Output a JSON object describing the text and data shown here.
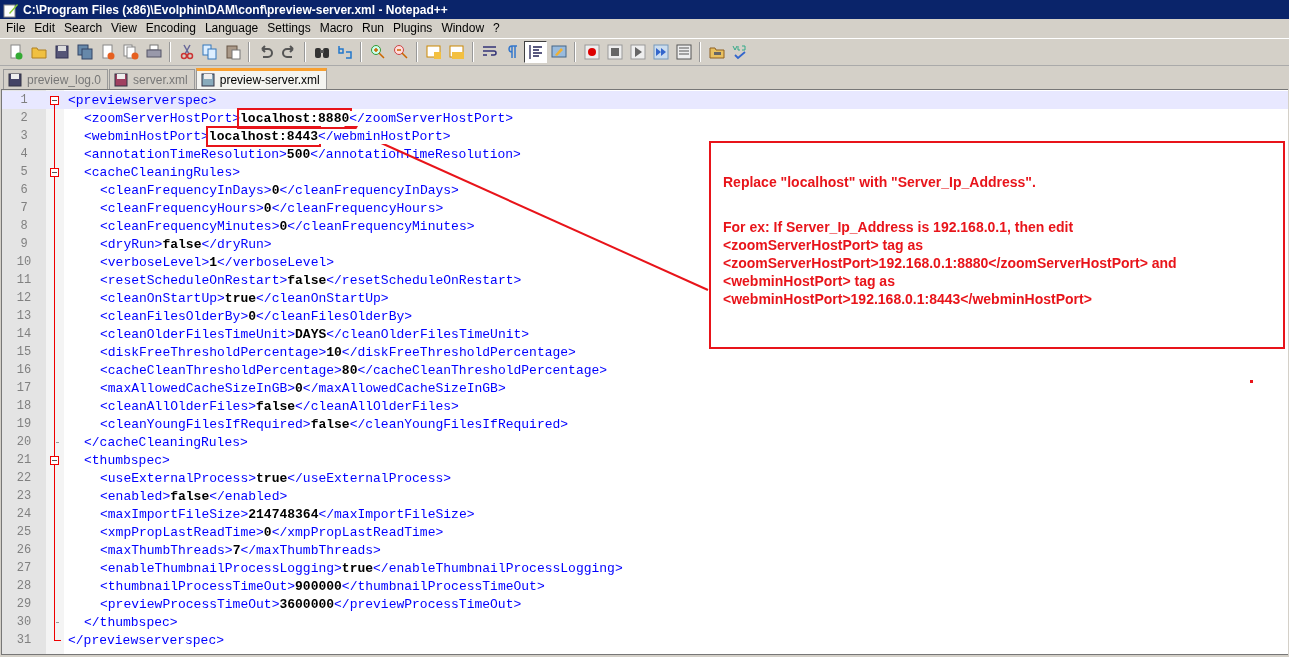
{
  "window": {
    "title": "C:\\Program Files (x86)\\Evolphin\\DAM\\conf\\preview-server.xml - Notepad++"
  },
  "menu": [
    "File",
    "Edit",
    "Search",
    "View",
    "Encoding",
    "Language",
    "Settings",
    "Macro",
    "Run",
    "Plugins",
    "Window",
    "?"
  ],
  "toolbar": [
    {
      "kind": "new",
      "pressed": false
    },
    {
      "kind": "open",
      "pressed": false
    },
    {
      "kind": "save",
      "pressed": false
    },
    {
      "kind": "save_all",
      "pressed": false
    },
    {
      "kind": "close",
      "pressed": false
    },
    {
      "kind": "close_all",
      "pressed": false
    },
    {
      "kind": "print",
      "pressed": false
    },
    {
      "kind": "separator"
    },
    {
      "kind": "cut",
      "pressed": false
    },
    {
      "kind": "copy",
      "pressed": false
    },
    {
      "kind": "paste",
      "pressed": false
    },
    {
      "kind": "separator"
    },
    {
      "kind": "undo",
      "pressed": false
    },
    {
      "kind": "redo",
      "pressed": false
    },
    {
      "kind": "separator"
    },
    {
      "kind": "find",
      "pressed": false
    },
    {
      "kind": "replace",
      "pressed": false
    },
    {
      "kind": "separator"
    },
    {
      "kind": "zoom_in",
      "pressed": false
    },
    {
      "kind": "zoom_out",
      "pressed": false
    },
    {
      "kind": "separator"
    },
    {
      "kind": "sync_vertical",
      "pressed": false
    },
    {
      "kind": "sync_horizontal",
      "pressed": false
    },
    {
      "kind": "separator"
    },
    {
      "kind": "word_wrap",
      "pressed": false
    },
    {
      "kind": "all_chars",
      "pressed": false
    },
    {
      "kind": "indent_guide",
      "pressed": true
    },
    {
      "kind": "monitor",
      "pressed": false
    },
    {
      "kind": "separator"
    },
    {
      "kind": "record",
      "pressed": false
    },
    {
      "kind": "stop",
      "pressed": false
    },
    {
      "kind": "play",
      "pressed": false
    },
    {
      "kind": "play_multiple",
      "pressed": false
    },
    {
      "kind": "save_macro",
      "pressed": false
    },
    {
      "kind": "separator"
    },
    {
      "kind": "folder",
      "pressed": false
    },
    {
      "kind": "spell_check",
      "pressed": false
    }
  ],
  "tabs": [
    {
      "label": "preview_log.0",
      "selected": false,
      "modified": false
    },
    {
      "label": "server.xml",
      "selected": false,
      "modified": true
    },
    {
      "label": "preview-server.xml",
      "selected": true,
      "modified": false
    }
  ],
  "editor": {
    "root": {
      "line": "1",
      "open": "<previewserverspec>",
      "close_line": "31",
      "close": "</previewserverspec>",
      "expanded": true,
      "current": true,
      "children": [
        {
          "line": "2",
          "open": "<zoomServerHostPort>",
          "value": "localhost:8880",
          "close": "</zoomServerHostPort>",
          "boxed": true,
          "current": false
        },
        {
          "line": "3",
          "open": "<webminHostPort>",
          "value": "localhost:8443",
          "close": "</webminHostPort>",
          "boxed": true,
          "current": false
        },
        {
          "line": "4",
          "open": "<annotationTimeResolution>",
          "value": "500",
          "close": "</annotationTimeResolution>",
          "boxed": false,
          "current": false
        },
        {
          "line": "5",
          "open": "<cacheCleaningRules>",
          "close_line": "20",
          "close": "</cacheCleaningRules>",
          "expanded": true,
          "current": false,
          "children": [
            {
              "line": "6",
              "open": "<cleanFrequencyInDays>",
              "value": "0",
              "close": "</cleanFrequencyInDays>",
              "boxed": false,
              "current": false
            },
            {
              "line": "7",
              "open": "<cleanFrequencyHours>",
              "value": "0",
              "close": "</cleanFrequencyHours>",
              "boxed": false,
              "current": false
            },
            {
              "line": "8",
              "open": "<cleanFrequencyMinutes>",
              "value": "0",
              "close": "</cleanFrequencyMinutes>",
              "boxed": false,
              "current": false
            },
            {
              "line": "9",
              "open": "<dryRun>",
              "value": "false",
              "close": "</dryRun>",
              "boxed": false,
              "current": false
            },
            {
              "line": "10",
              "open": "<verboseLevel>",
              "value": "1",
              "close": "</verboseLevel>",
              "boxed": false,
              "current": false
            },
            {
              "line": "11",
              "open": "<resetScheduleOnRestart>",
              "value": "false",
              "close": "</resetScheduleOnRestart>",
              "boxed": false,
              "current": false
            },
            {
              "line": "12",
              "open": "<cleanOnStartUp>",
              "value": "true",
              "close": "</cleanOnStartUp>",
              "boxed": false,
              "current": false
            },
            {
              "line": "13",
              "open": "<cleanFilesOlderBy>",
              "value": "0",
              "close": "</cleanFilesOlderBy>",
              "boxed": false,
              "current": false
            },
            {
              "line": "14",
              "open": "<cleanOlderFilesTimeUnit>",
              "value": "DAYS",
              "close": "</cleanOlderFilesTimeUnit>",
              "boxed": false,
              "current": false
            },
            {
              "line": "15",
              "open": "<diskFreeThresholdPercentage>",
              "value": "10",
              "close": "</diskFreeThresholdPercentage>",
              "boxed": false,
              "current": false
            },
            {
              "line": "16",
              "open": "<cacheCleanThresholdPercentage>",
              "value": "80",
              "close": "</cacheCleanThresholdPercentage>",
              "boxed": false,
              "current": false
            },
            {
              "line": "17",
              "open": "<maxAllowedCacheSizeInGB>",
              "value": "0",
              "close": "</maxAllowedCacheSizeInGB>",
              "boxed": false,
              "current": false
            },
            {
              "line": "18",
              "open": "<cleanAllOlderFiles>",
              "value": "false",
              "close": "</cleanAllOlderFiles>",
              "boxed": false,
              "current": false
            },
            {
              "line": "19",
              "open": "<cleanYoungFilesIfRequired>",
              "value": "false",
              "close": "</cleanYoungFilesIfRequired>",
              "boxed": false,
              "current": false
            }
          ]
        },
        {
          "line": "21",
          "open": "<thumbspec>",
          "close_line": "30",
          "close": "</thumbspec>",
          "expanded": true,
          "current": false,
          "children": [
            {
              "line": "22",
              "open": "<useExternalProcess>",
              "value": "true",
              "close": "</useExternalProcess>",
              "boxed": false,
              "current": false
            },
            {
              "line": "23",
              "open": "<enabled>",
              "value": "false",
              "close": "</enabled>",
              "boxed": false,
              "current": false
            },
            {
              "line": "24",
              "open": "<maxImportFileSize>",
              "value": "214748364",
              "close": "</maxImportFileSize>",
              "boxed": false,
              "current": false
            },
            {
              "line": "25",
              "open": "<xmpPropLastReadTime>",
              "value": "0",
              "close": "</xmpPropLastReadTime>",
              "boxed": false,
              "current": false
            },
            {
              "line": "26",
              "open": "<maxThumbThreads>",
              "value": "7",
              "close": "</maxThumbThreads>",
              "boxed": false,
              "current": false
            },
            {
              "line": "27",
              "open": "<enableThumbnailProcessLogging>",
              "value": "true",
              "close": "</enableThumbnailProcessLogging>",
              "boxed": false,
              "current": false
            },
            {
              "line": "28",
              "open": "<thumbnailProcessTimeOut>",
              "value": "900000",
              "close": "</thumbnailProcessTimeOut>",
              "boxed": false,
              "current": false
            },
            {
              "line": "29",
              "open": "<previewProcessTimeOut>",
              "value": "3600000",
              "close": "</previewProcessTimeOut>",
              "boxed": false,
              "current": false
            }
          ]
        }
      ]
    }
  },
  "note": {
    "heading": "Replace \"localhost\" with \"Server_Ip_Address\".",
    "lines": [
      "For ex: If Server_Ip_Address is 192.168.0.1, then edit",
      "<zoomServerHostPort> tag as",
      "<zoomServerHostPort>192.168.0.1:8880</zoomServerHostPort> and",
      "<webminHostPort> tag as",
      "<webminHostPort>192.168.0.1:8443</webminHostPort>"
    ]
  }
}
